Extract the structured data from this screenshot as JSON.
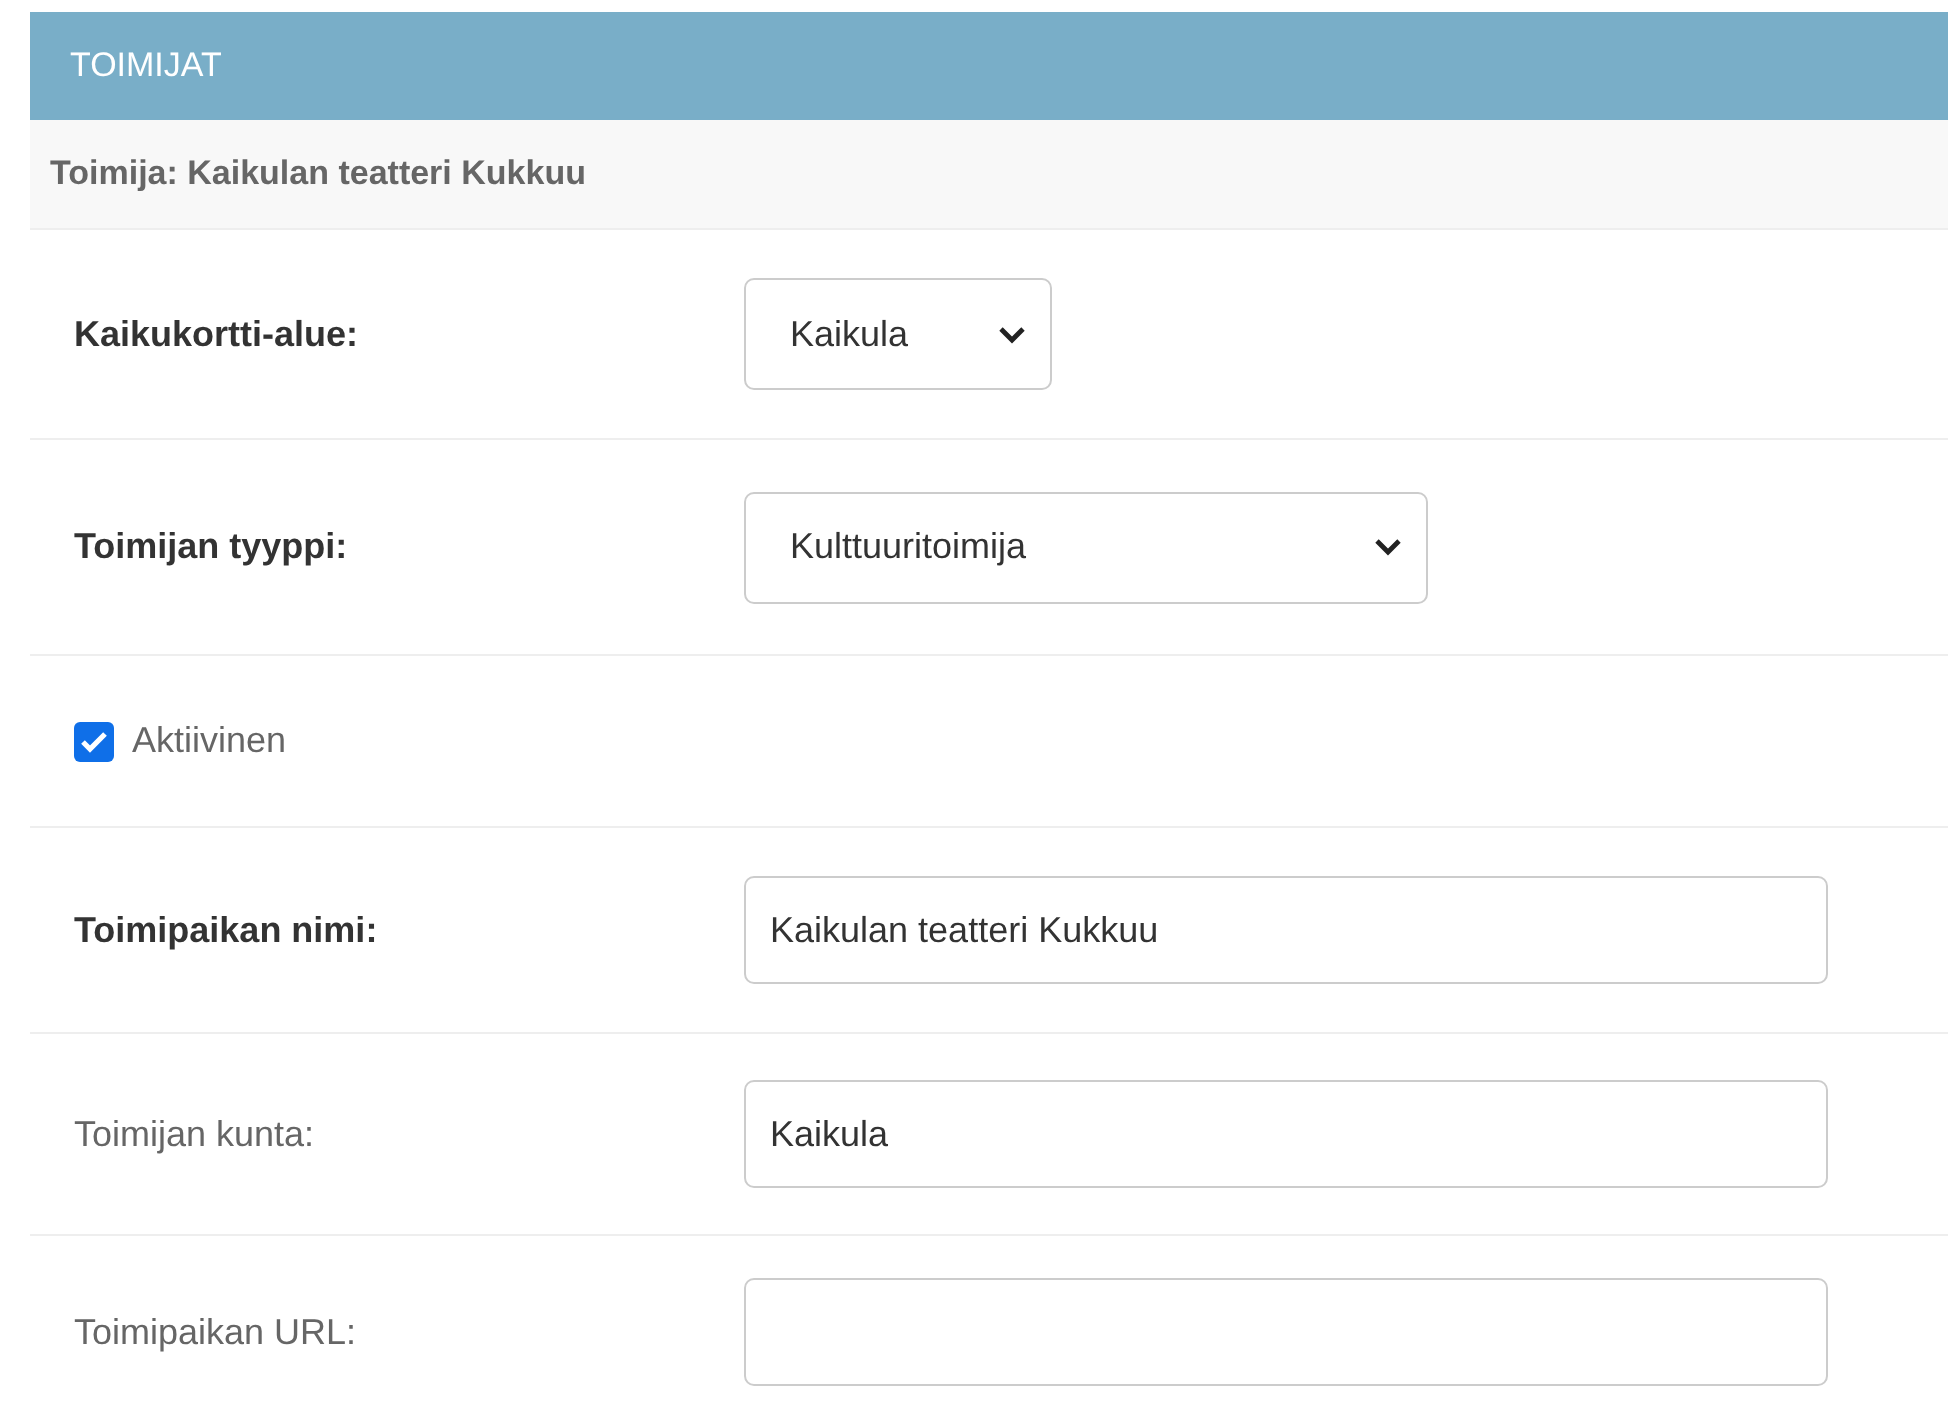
{
  "header": {
    "title": "TOIMIJAT"
  },
  "subheader": {
    "title": "Toimija: Kaikulan teatteri Kukkuu"
  },
  "fields": [
    {
      "kind": "select",
      "label": "Kaikukortti-alue:",
      "required": true,
      "value": "Kaikula"
    },
    {
      "kind": "select",
      "label": "Toimijan tyyppi:",
      "required": true,
      "value": "Kulttuuritoimija"
    },
    {
      "kind": "checkbox",
      "label": "Aktiivinen",
      "checked": true
    },
    {
      "kind": "text",
      "label": "Toimipaikan nimi:",
      "required": true,
      "value": "Kaikulan teatteri Kukkuu"
    },
    {
      "kind": "text",
      "label": "Toimijan kunta:",
      "required": false,
      "value": "Kaikula"
    },
    {
      "kind": "text",
      "label": "Toimipaikan URL:",
      "required": false
    }
  ]
}
